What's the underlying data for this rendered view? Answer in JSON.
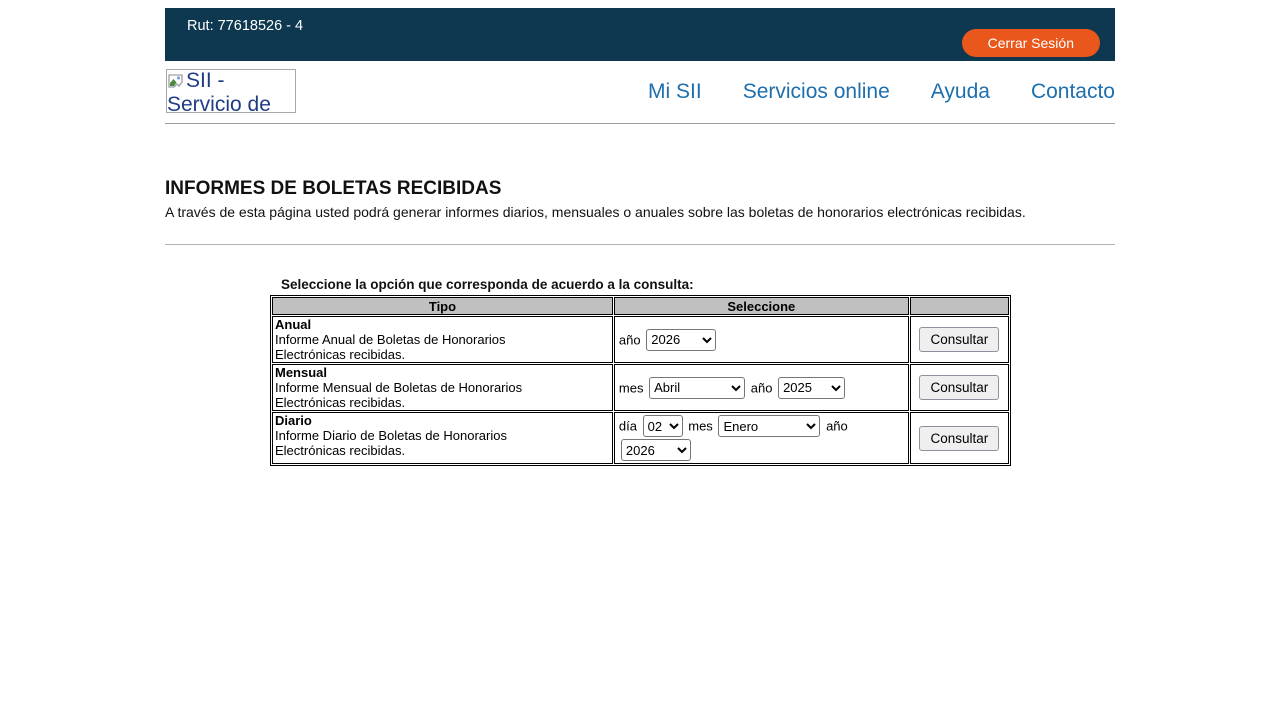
{
  "topbar": {
    "rut": "Rut: 77618526 - 4",
    "logout_label": "Cerrar Sesión"
  },
  "header": {
    "logo_alt": "SII - Servicio de",
    "nav": [
      {
        "label": "Mi SII"
      },
      {
        "label": "Servicios online"
      },
      {
        "label": "Ayuda"
      },
      {
        "label": "Contacto"
      }
    ]
  },
  "main": {
    "title": "INFORMES DE BOLETAS RECIBIDAS",
    "description": "A través de esta página usted podrá generar informes diarios, mensuales o anuales sobre las boletas de honorarios electrónicas recibidas.",
    "instruction": "Seleccione la opción que corresponda de acuerdo a la consulta:",
    "table": {
      "headers": [
        "Tipo",
        "Seleccione",
        ""
      ],
      "consult_label": "Consultar",
      "rows": [
        {
          "type": "Anual",
          "desc_line1": "Informe Anual de Boletas de Honorarios",
          "desc_line2": "Electrónicas recibidas.",
          "year_label": "año",
          "year_value": "2026"
        },
        {
          "type": "Mensual",
          "desc_line1": "Informe Mensual de Boletas de Honorarios",
          "desc_line2": "Electrónicas recibidas.",
          "month_label": "mes",
          "month_value": "Abril",
          "year_label": "año",
          "year_value": "2025"
        },
        {
          "type": "Diario",
          "desc_line1": "Informe Diario de Boletas de Honorarios",
          "desc_line2": "Electrónicas recibidas.",
          "day_label": "día",
          "day_value": "02",
          "month_label": "mes",
          "month_value": "Enero",
          "year_label": "año",
          "year_value": "2026"
        }
      ]
    }
  },
  "colors": {
    "topbar_bg": "#0d3850",
    "logout_orange": "#e9571c",
    "nav_link_blue": "#1e6fad",
    "table_header_bg": "#c0c0c0",
    "table_border": "#000000"
  }
}
